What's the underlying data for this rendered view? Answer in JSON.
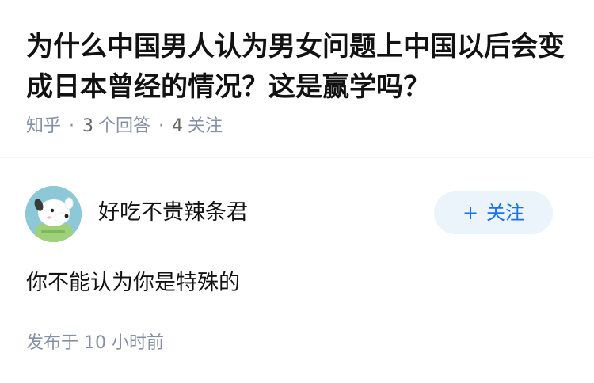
{
  "question": {
    "title": "为什么中国男人认为男女问题上中国以后会变成日本曾经的情况？这是赢学吗？",
    "source": "知乎",
    "separator": "·",
    "answer_count": "3",
    "answer_label": "个回答",
    "follow_count": "4",
    "follow_label": "关注"
  },
  "answer": {
    "author_name": "好吃不贵辣条君",
    "avatar_icon": "cartoon-dog-avatar",
    "follow_plus": "+",
    "follow_label": "关注",
    "text": "你不能认为你是特殊的",
    "published_label": "发布于",
    "published_time": "10 小时前"
  },
  "colors": {
    "accent": "#1772f6",
    "follow_bg": "#ebf3fb",
    "meta_text": "#8590a6"
  }
}
